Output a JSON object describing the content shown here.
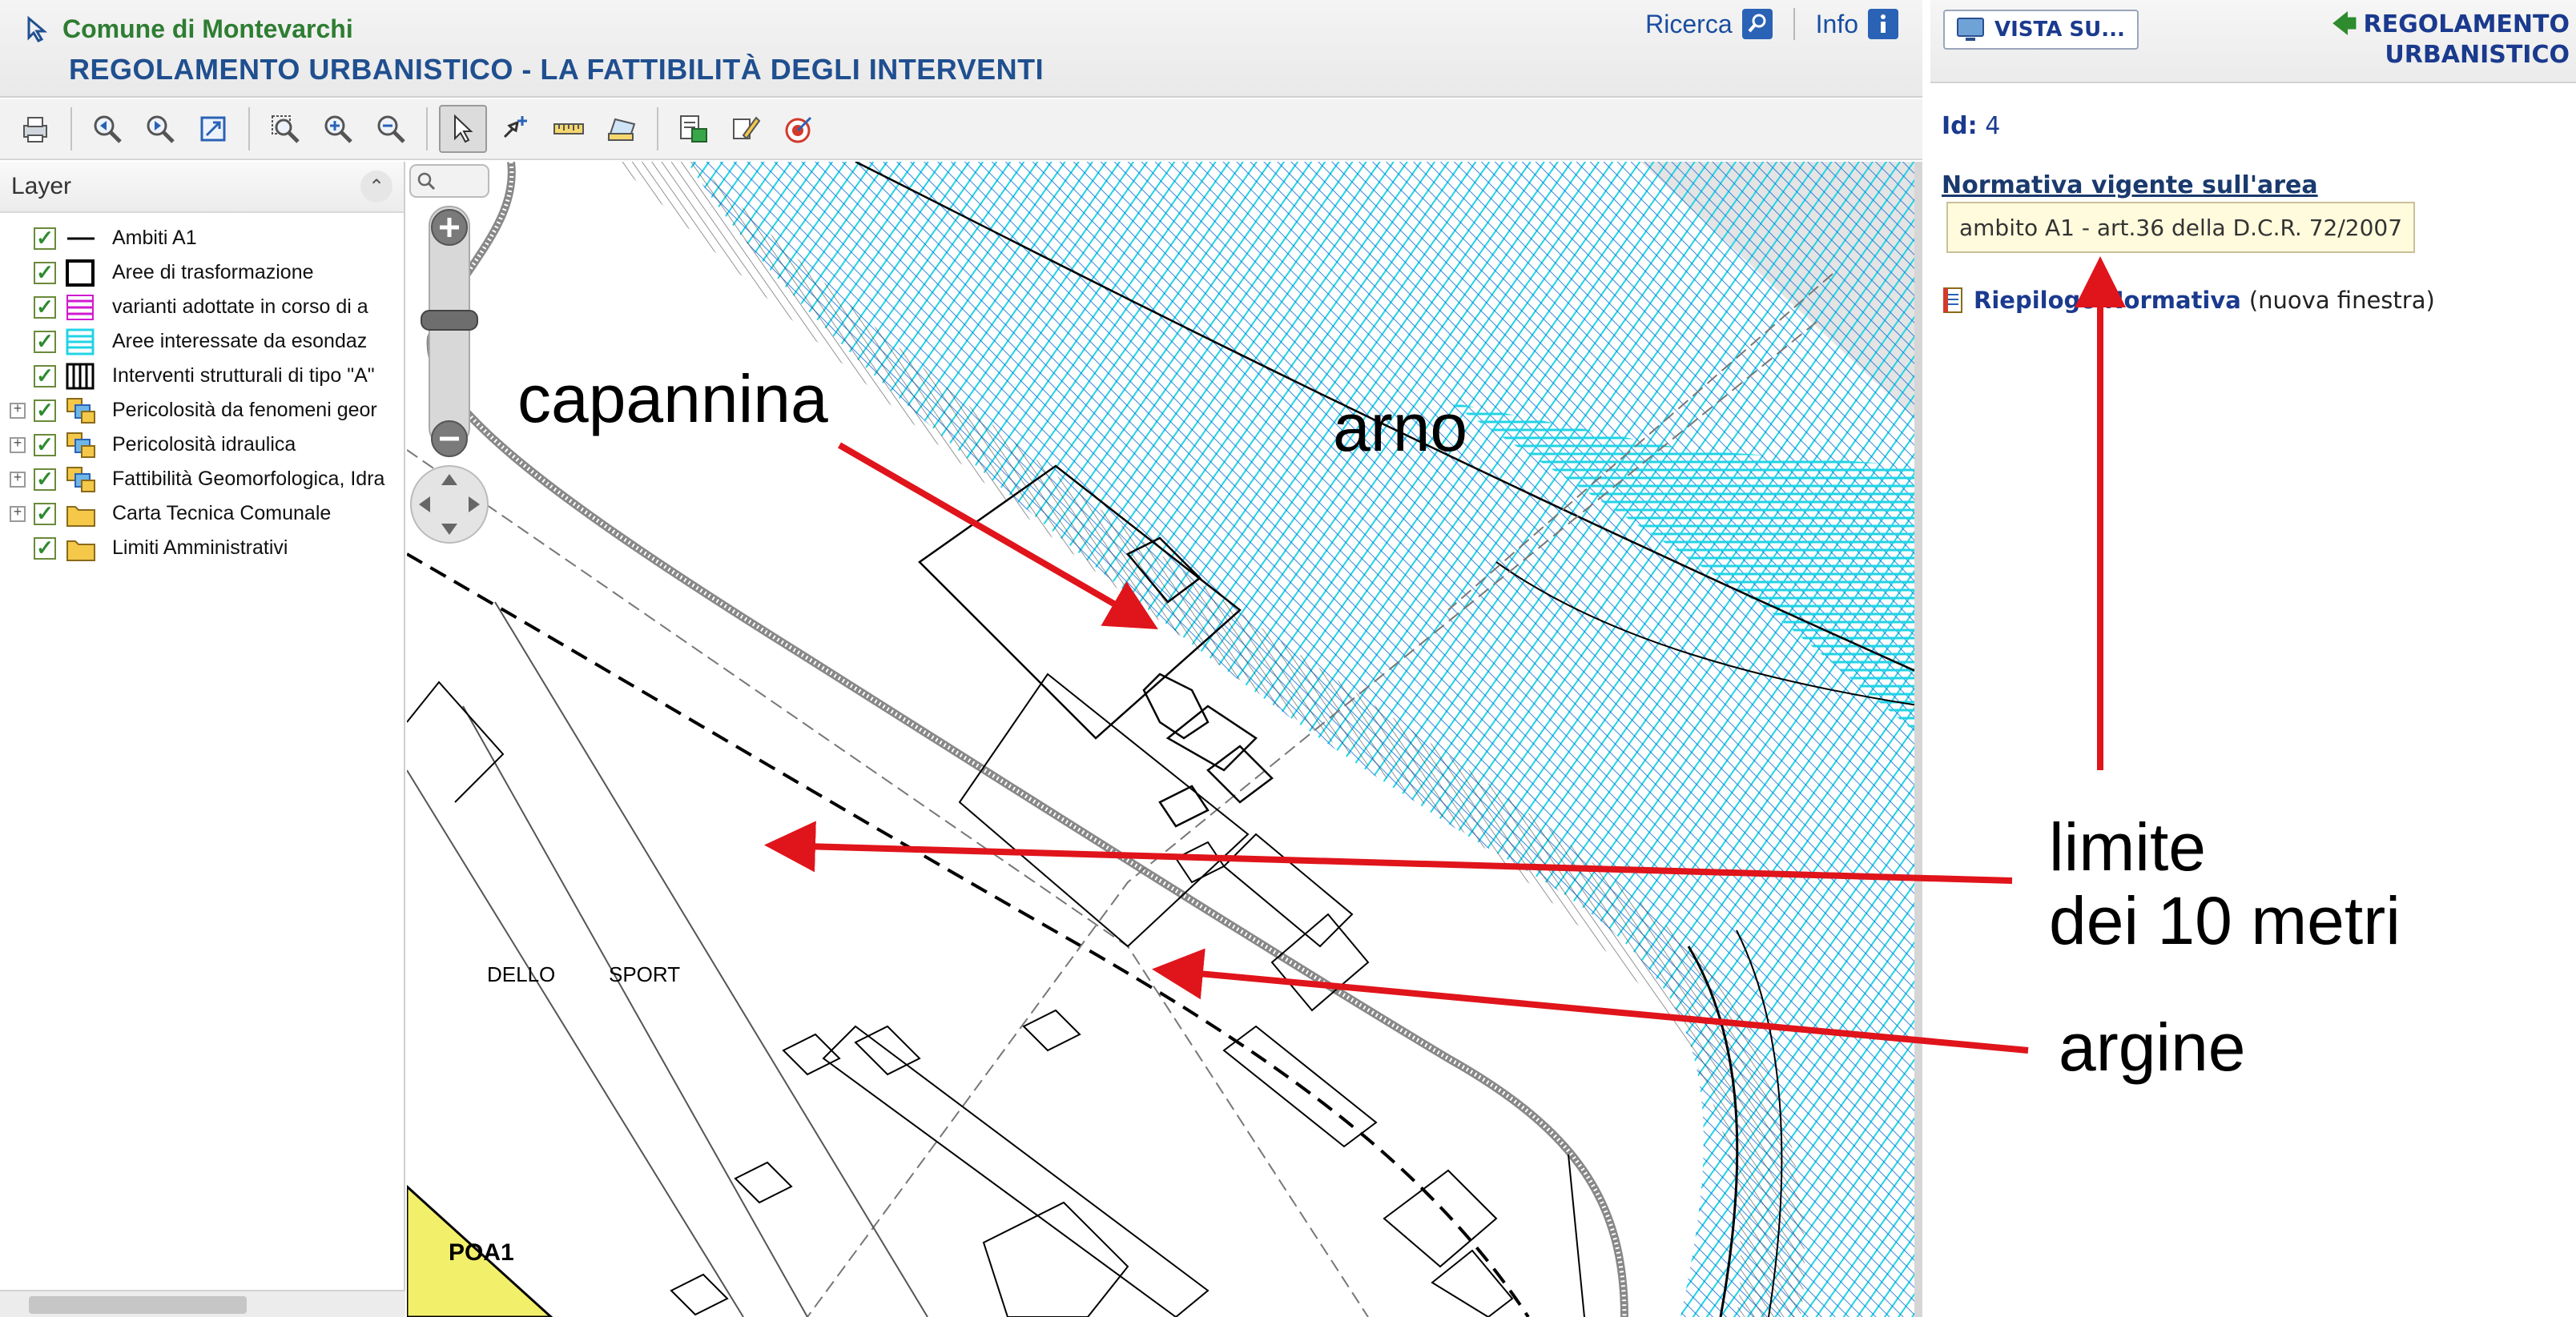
{
  "header": {
    "org_name": "Comune di Montevarchi",
    "app_title": "REGOLAMENTO URBANISTICO - LA FATTIBILITÀ DEGLI INTERVENTI",
    "search_label": "Ricerca",
    "info_label": "Info"
  },
  "toolbar": {
    "tools": [
      "print-icon",
      "zoom-prev-icon",
      "zoom-next-icon",
      "full-extent-icon",
      "zoom-box-icon",
      "zoom-in-icon",
      "zoom-out-icon",
      "select-icon",
      "pan-icon",
      "measure-icon",
      "measure-area-icon",
      "identify-icon",
      "edit-icon",
      "target-icon"
    ],
    "active_tool": "select-icon"
  },
  "layer_panel": {
    "title": "Layer",
    "layers": [
      {
        "label": "Ambiti A1",
        "checked": true,
        "expandable": false,
        "symbol": "line"
      },
      {
        "label": "Aree di trasformazione",
        "checked": true,
        "expandable": false,
        "symbol": "box"
      },
      {
        "label": "varianti adottate in corso di a",
        "checked": true,
        "expandable": false,
        "symbol": "magenta-stripes"
      },
      {
        "label": "Aree interessate da esondaz",
        "checked": true,
        "expandable": false,
        "symbol": "cyan-stripes"
      },
      {
        "label": "Interventi strutturali di tipo \"A\"",
        "checked": true,
        "expandable": false,
        "symbol": "vertical-stripes"
      },
      {
        "label": "Pericolosità da fenomeni geor",
        "checked": true,
        "expandable": true,
        "symbol": "group"
      },
      {
        "label": "Pericolosità idraulica",
        "checked": true,
        "expandable": true,
        "symbol": "group"
      },
      {
        "label": "Fattibilità Geomorfologica, Idra",
        "checked": true,
        "expandable": true,
        "symbol": "group"
      },
      {
        "label": "Carta Tecnica Comunale",
        "checked": true,
        "expandable": true,
        "symbol": "folder"
      },
      {
        "label": "Limiti Amministrativi",
        "checked": true,
        "expandable": false,
        "symbol": "folder"
      }
    ]
  },
  "map": {
    "labels": {
      "dello": "DELLO",
      "sport": "SPORT",
      "poa": "POA1"
    }
  },
  "right_panel": {
    "vista_label": "VISTA SU...",
    "back_line1": "REGOLAMENTO",
    "back_line2": "URBANISTICO",
    "id_label": "Id:",
    "id_value": "4",
    "normativa_title": "Normativa vigente sull'area",
    "normativa_value": "ambito A1 - art.36 della D.C.R. 72/2007",
    "riepilogo_link": "Riepilogo Normativa",
    "riepilogo_note": "(nuova finestra)"
  },
  "annotations": {
    "capannina": "capannina",
    "arno": "arno",
    "limite_line1": "limite",
    "limite_line2": "dei 10 metri",
    "argine": "argine",
    "arrow_color": "#e0141b"
  },
  "colors": {
    "title_blue": "#1f4f8f",
    "org_green": "#2e7d32",
    "hatch_cyan": "#22d3e6",
    "hatch_blue": "#1a6fd6",
    "poa_yellow": "#f2f06a"
  }
}
